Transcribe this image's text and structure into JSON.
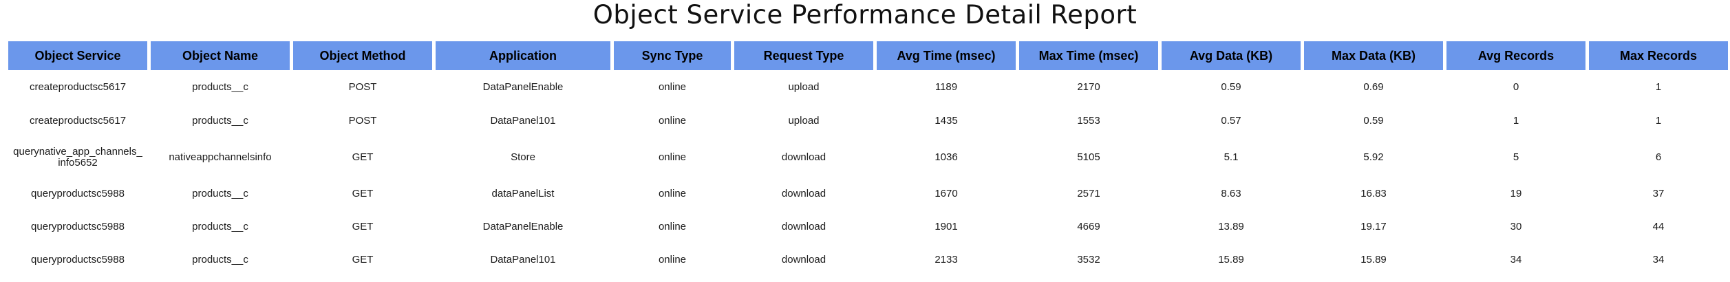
{
  "report": {
    "title": "Object Service Performance Detail Report",
    "header_color": "#6b97eb"
  },
  "columns": [
    "Object Service",
    "Object Name",
    "Object Method",
    "Application",
    "Sync Type",
    "Request Type",
    "Avg Time (msec)",
    "Max Time (msec)",
    "Avg Data (KB)",
    "Max Data (KB)",
    "Avg Records",
    "Max Records"
  ],
  "rows": [
    [
      "createproductsc5617",
      "products__c",
      "POST",
      "DataPanelEnable",
      "online",
      "upload",
      "1189",
      "2170",
      "0.59",
      "0.69",
      "0",
      "1"
    ],
    [
      "createproductsc5617",
      "products__c",
      "POST",
      "DataPanel101",
      "online",
      "upload",
      "1435",
      "1553",
      "0.57",
      "0.59",
      "1",
      "1"
    ],
    [
      "querynative_app_channels_info5652",
      "nativeappchannelsinfo",
      "GET",
      "Store",
      "online",
      "download",
      "1036",
      "5105",
      "5.1",
      "5.92",
      "5",
      "6"
    ],
    [
      "queryproductsc5988",
      "products__c",
      "GET",
      "dataPanelList",
      "online",
      "download",
      "1670",
      "2571",
      "8.63",
      "16.83",
      "19",
      "37"
    ],
    [
      "queryproductsc5988",
      "products__c",
      "GET",
      "DataPanelEnable",
      "online",
      "download",
      "1901",
      "4669",
      "13.89",
      "19.17",
      "30",
      "44"
    ],
    [
      "queryproductsc5988",
      "products__c",
      "GET",
      "DataPanel101",
      "online",
      "download",
      "2133",
      "3532",
      "15.89",
      "15.89",
      "34",
      "34"
    ]
  ]
}
